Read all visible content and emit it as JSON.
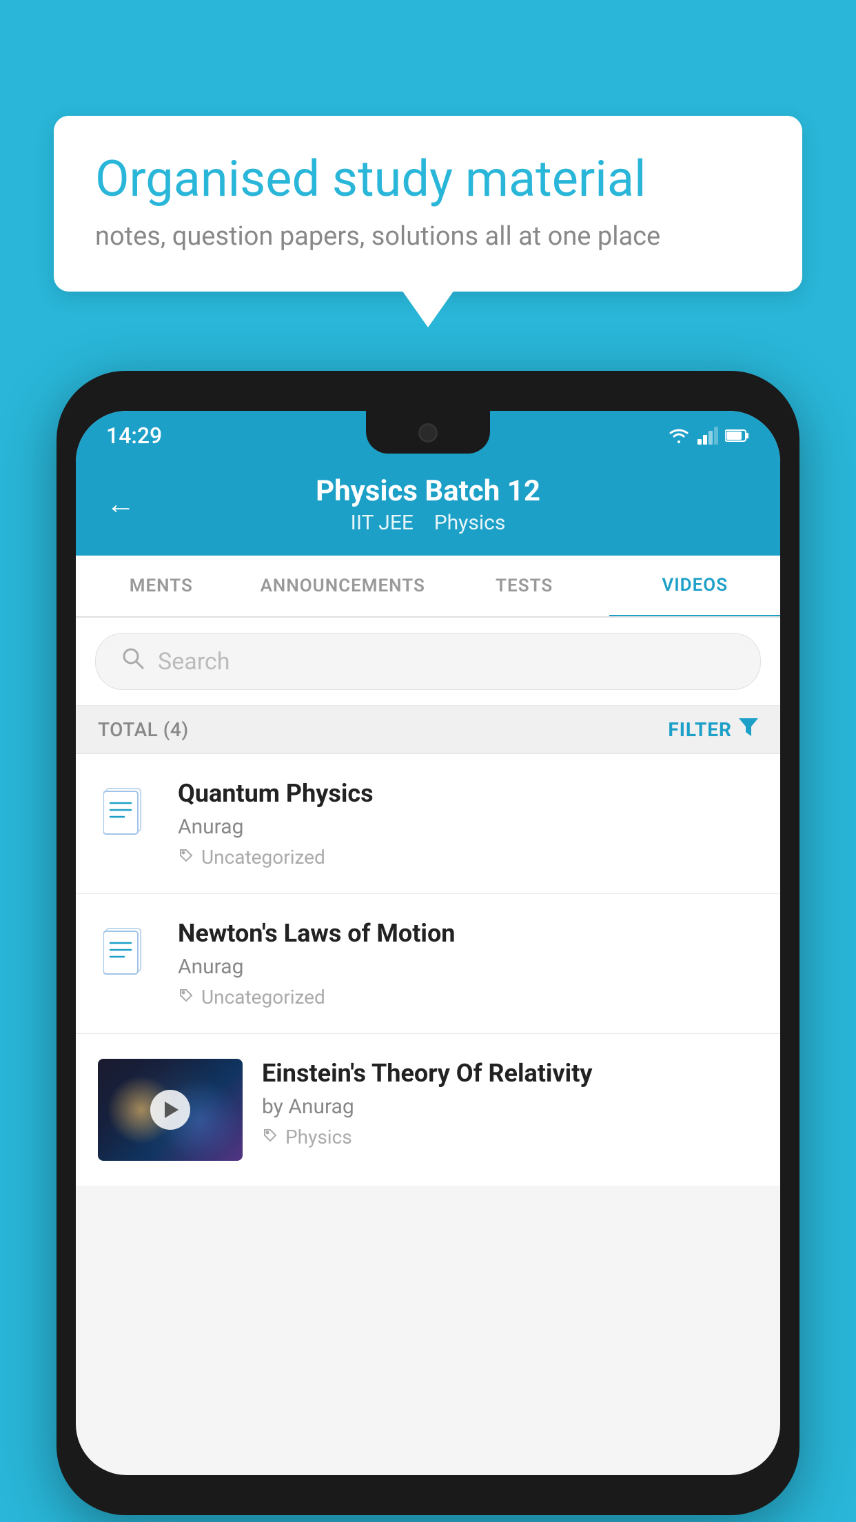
{
  "background_color": "#29b6d8",
  "speech_bubble": {
    "title": "Organised study material",
    "subtitle": "notes, question papers, solutions all at one place"
  },
  "phone": {
    "status_bar": {
      "time": "14:29",
      "icons": [
        "wifi",
        "signal",
        "battery"
      ]
    },
    "header": {
      "back_label": "←",
      "title": "Physics Batch 12",
      "subtitle_part1": "IIT JEE",
      "subtitle_part2": "Physics"
    },
    "tabs": [
      {
        "label": "MENTS",
        "active": false
      },
      {
        "label": "ANNOUNCEMENTS",
        "active": false
      },
      {
        "label": "TESTS",
        "active": false
      },
      {
        "label": "VIDEOS",
        "active": true
      }
    ],
    "search": {
      "placeholder": "Search"
    },
    "filter_bar": {
      "total_label": "TOTAL (4)",
      "filter_label": "FILTER"
    },
    "videos": [
      {
        "title": "Quantum Physics",
        "author": "Anurag",
        "tag": "Uncategorized",
        "has_thumbnail": false
      },
      {
        "title": "Newton's Laws of Motion",
        "author": "Anurag",
        "tag": "Uncategorized",
        "has_thumbnail": false
      },
      {
        "title": "Einstein's Theory Of Relativity",
        "author": "by Anurag",
        "tag": "Physics",
        "has_thumbnail": true
      }
    ]
  }
}
